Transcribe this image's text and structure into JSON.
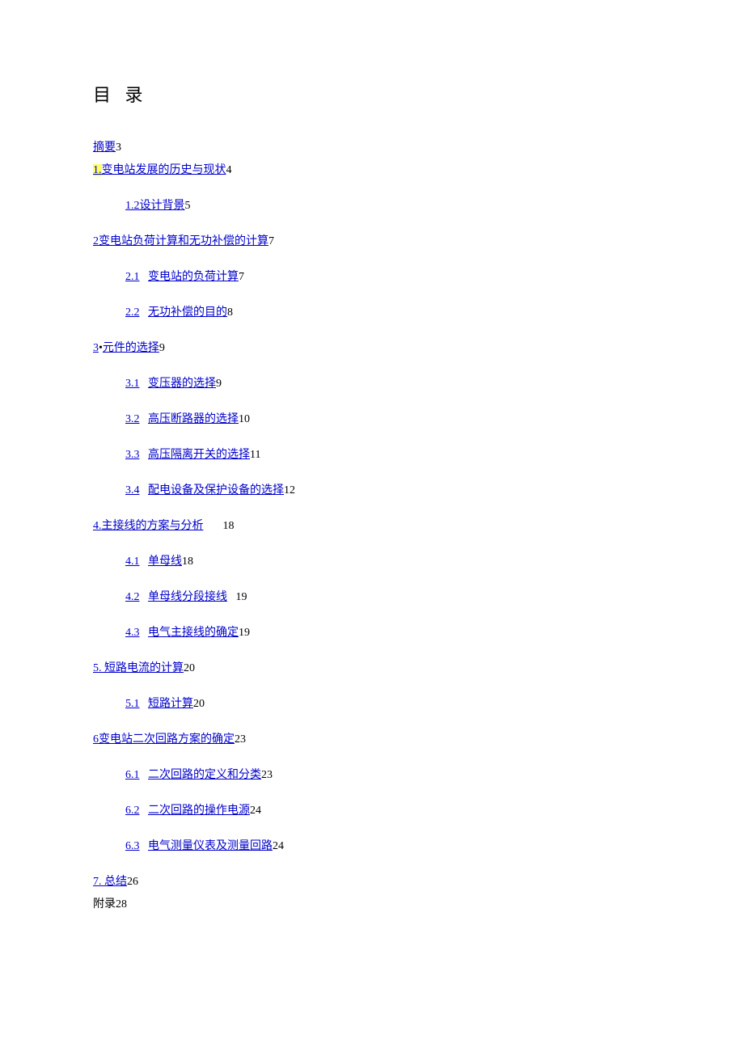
{
  "title": "目 录",
  "toc": {
    "abstract": {
      "label": "摘要",
      "page": "3"
    },
    "s1": {
      "num": "1.",
      "label": "变电站发展的历史与现状",
      "page": "4"
    },
    "s1_2": {
      "num": "1.2",
      "label": "设计背景",
      "page": "5"
    },
    "s2": {
      "num": "2",
      "label": "变电站负荷计算和无功补偿的计算",
      "page": "7"
    },
    "s2_1": {
      "num": "2.1",
      "label": "变电站的负荷计算",
      "page": "7"
    },
    "s2_2": {
      "num": "2.2",
      "label": "无功补偿的目的",
      "page": "8"
    },
    "s3": {
      "num": "3",
      "bullet": "•",
      "label": "元件的选择",
      "page": "9"
    },
    "s3_1": {
      "num": "3.1",
      "label": "变压器的选择",
      "page": "9"
    },
    "s3_2": {
      "num": "3.2",
      "label": "高压断路器的选择",
      "page": "10"
    },
    "s3_3": {
      "num": "3.3",
      "label": "高压隔离开关的选择",
      "page": "11"
    },
    "s3_4": {
      "num": "3.4",
      "label": "配电设备及保护设备的选择",
      "page": "12"
    },
    "s4": {
      "num": "4.",
      "label": "主接线的方案与分析",
      "page": "18"
    },
    "s4_1": {
      "num": "4.1",
      "label": "单母线",
      "page": "18"
    },
    "s4_2": {
      "num": "4.2",
      "label": "单母线分段接线",
      "page": "19"
    },
    "s4_3": {
      "num": "4.3",
      "label": "电气主接线的确定",
      "page": "19"
    },
    "s5": {
      "num": "5.",
      "label": " 短路电流的计算",
      "page": "20"
    },
    "s5_1": {
      "num": "5.1",
      "label": "短路计算",
      "page": "20"
    },
    "s6": {
      "num": "6",
      "label": "变电站二次回路方案的确定",
      "page": "23"
    },
    "s6_1": {
      "num": "6.1",
      "label": "二次回路的定义和分类",
      "page": "23"
    },
    "s6_2": {
      "num": "6.2",
      "label": "二次回路的操作电源",
      "page": "24"
    },
    "s6_3": {
      "num": "6.3",
      "label": "电气测量仪表及测量回路",
      "page": "24"
    },
    "s7": {
      "num": "7.",
      "label": " 总结",
      "page": "26"
    },
    "appendix": {
      "label": "附录",
      "page": "28"
    }
  }
}
